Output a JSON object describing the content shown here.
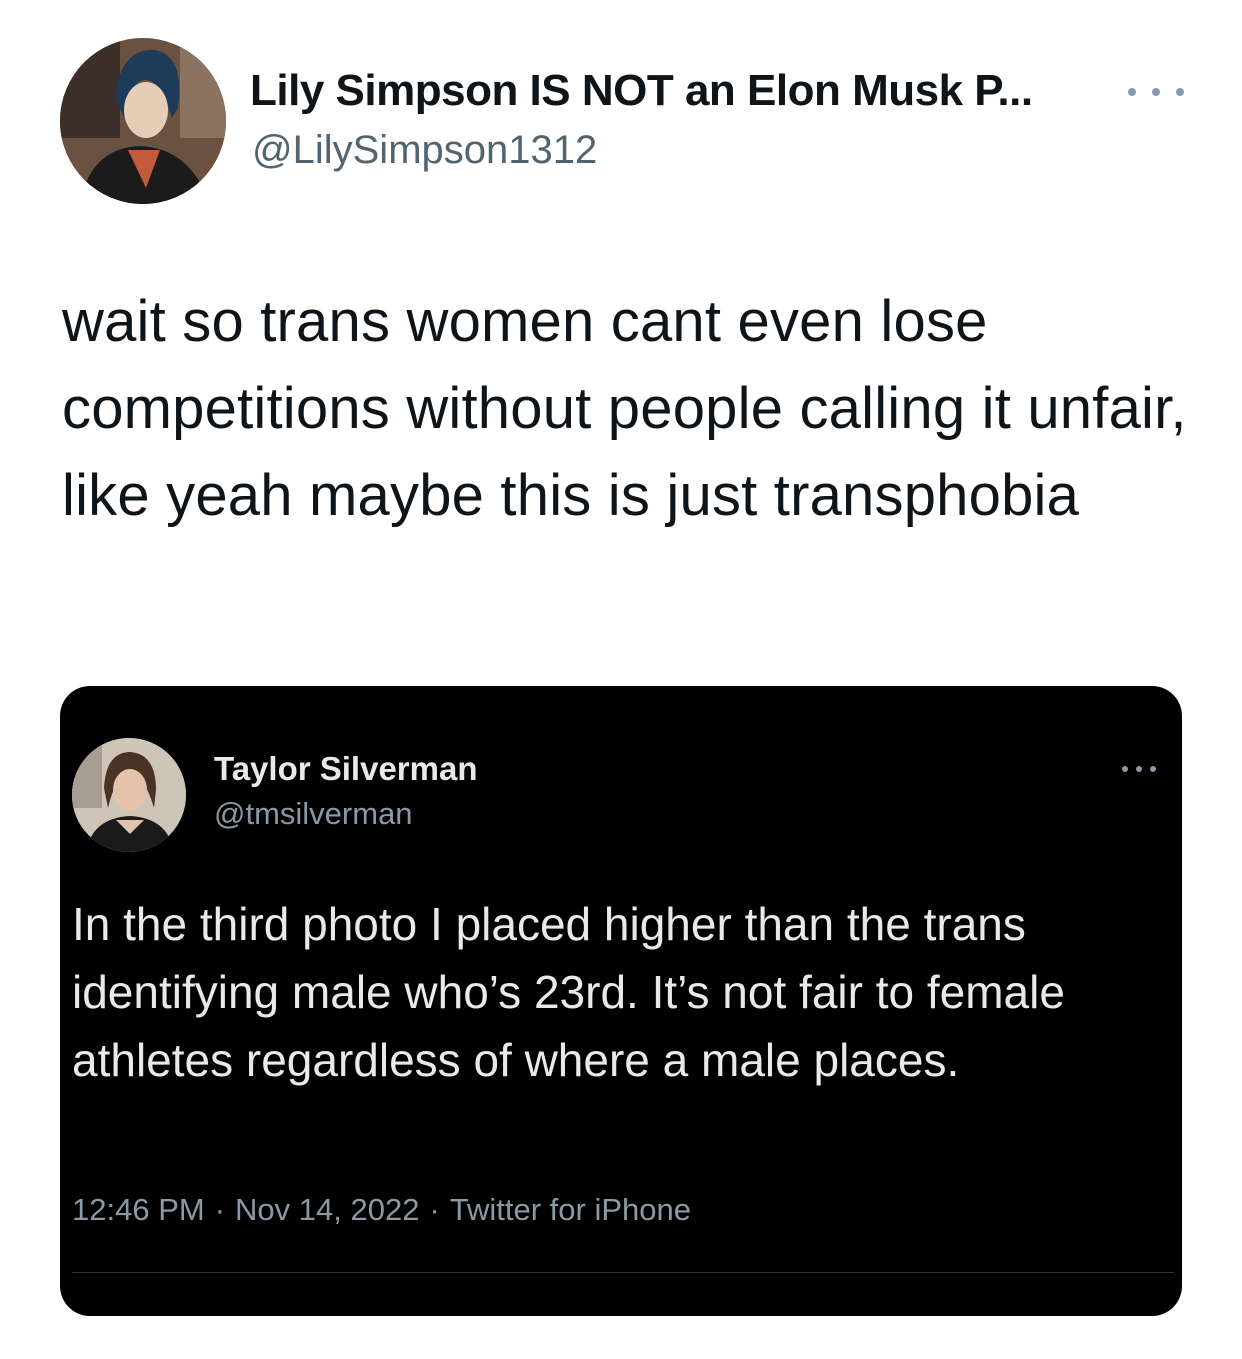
{
  "tweet": {
    "author_name": "Lily Simpson IS NOT an Elon Musk P...",
    "author_handle": "@LilySimpson1312",
    "more_icon": "more-horizontal-icon",
    "text": "wait so trans women cant even lose competitions without people calling it unfair, like yeah maybe this is just transphobia"
  },
  "embedded": {
    "author_name": "Taylor Silverman",
    "author_handle": "@tmsilverman",
    "more_icon": "more-horizontal-icon",
    "text": "In the third photo I placed higher than the trans identifying male who’s 23rd. It’s not fair to female athletes regardless of where a male places.",
    "time": "12:46 PM",
    "date": "Nov 14, 2022",
    "source": "Twitter for iPhone",
    "separator": "·"
  },
  "colors": {
    "background": "#ffffff",
    "text_primary": "#0f1419",
    "text_secondary": "#536471",
    "embed_background": "#000000",
    "embed_text": "#e7e9ea",
    "embed_secondary": "#8b98a5"
  }
}
